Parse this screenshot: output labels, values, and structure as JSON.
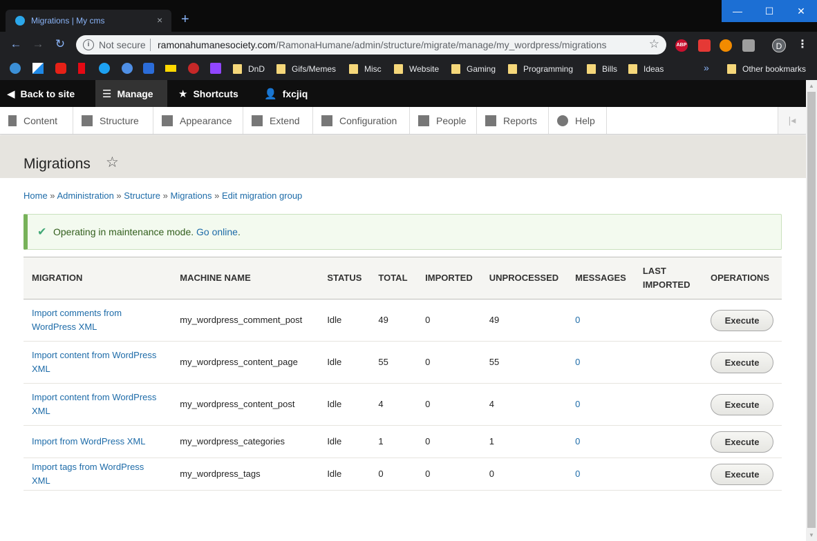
{
  "browser": {
    "tab_title": "Migrations | My cms",
    "tab_close": "×",
    "new_tab": "+",
    "not_secure": "Not secure",
    "url_host": "ramonahumanesociety.com",
    "url_path": "/RamonaHumane/admin/structure/migrate/manage/my_wordpress/migrations",
    "profile_initial": "D",
    "window_controls": [
      "—",
      "☐",
      "✕"
    ],
    "bookmark_folders": [
      "DnD",
      "Gifs/Memes",
      "Misc",
      "Website",
      "Gaming",
      "Programming",
      "Bills",
      "Ideas"
    ],
    "bookmark_more": "»",
    "other_bookmarks": "Other bookmarks",
    "ext_abp": "ABP"
  },
  "admin_toolbar": {
    "back": "Back to site",
    "manage": "Manage",
    "shortcuts": "Shortcuts",
    "user": "fxcjiq"
  },
  "admin_tray": [
    "Content",
    "Structure",
    "Appearance",
    "Extend",
    "Configuration",
    "People",
    "Reports",
    "Help"
  ],
  "page": {
    "title": "Migrations",
    "breadcrumb": [
      "Home",
      "Administration",
      "Structure",
      "Migrations",
      "Edit migration group"
    ],
    "message": "Operating in maintenance mode.",
    "message_link": "Go online",
    "message_end": "."
  },
  "table": {
    "headers": [
      "MIGRATION",
      "MACHINE NAME",
      "STATUS",
      "TOTAL",
      "IMPORTED",
      "UNPROCESSED",
      "MESSAGES",
      "LAST IMPORTED",
      "OPERATIONS"
    ],
    "execute_label": "Execute",
    "rows": [
      {
        "migration": "Import comments from WordPress XML",
        "machine": "my_wordpress_comment_post",
        "status": "Idle",
        "total": "49",
        "imported": "0",
        "unprocessed": "49",
        "messages": "0",
        "last": ""
      },
      {
        "migration": "Import content from WordPress XML",
        "machine": "my_wordpress_content_page",
        "status": "Idle",
        "total": "55",
        "imported": "0",
        "unprocessed": "55",
        "messages": "0",
        "last": ""
      },
      {
        "migration": "Import content from WordPress XML",
        "machine": "my_wordpress_content_post",
        "status": "Idle",
        "total": "4",
        "imported": "0",
        "unprocessed": "4",
        "messages": "0",
        "last": ""
      },
      {
        "migration": "Import from WordPress XML",
        "machine": "my_wordpress_categories",
        "status": "Idle",
        "total": "1",
        "imported": "0",
        "unprocessed": "1",
        "messages": "0",
        "last": ""
      },
      {
        "migration": "Import tags from WordPress XML",
        "machine": "my_wordpress_tags",
        "status": "Idle",
        "total": "0",
        "imported": "0",
        "unprocessed": "0",
        "messages": "0",
        "last": ""
      }
    ]
  }
}
